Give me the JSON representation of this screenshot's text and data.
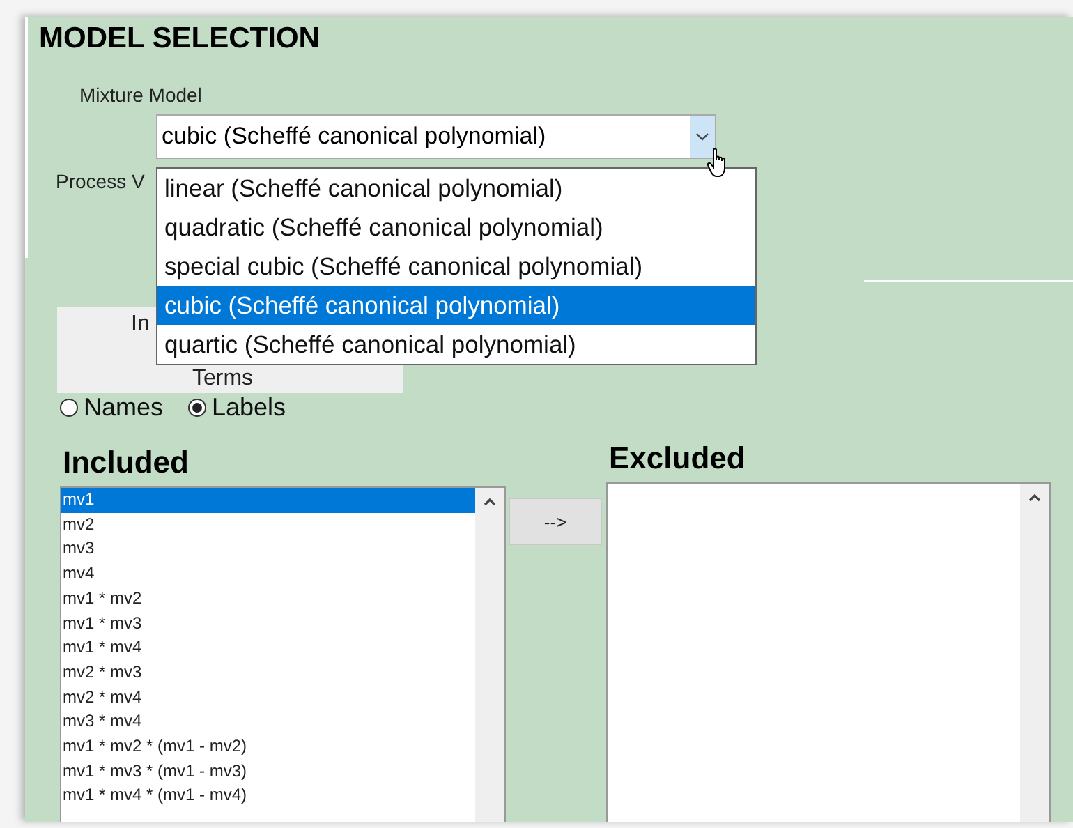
{
  "title": "MODEL SELECTION",
  "mixture_model": {
    "label": "Mixture Model",
    "value": "cubic (Scheffé canonical polynomial)",
    "expanded": true,
    "options": [
      {
        "label": "linear (Scheffé canonical polynomial)",
        "selected": false
      },
      {
        "label": "quadratic (Scheffé canonical polynomial)",
        "selected": false
      },
      {
        "label": "special cubic (Scheffé canonical polynomial)",
        "selected": false
      },
      {
        "label": "cubic (Scheffé canonical polynomial)",
        "selected": true
      },
      {
        "label": "quartic (Scheffé canonical polynomial)",
        "selected": false
      }
    ]
  },
  "process_label": "Process V",
  "terms_button": {
    "line_1": "In",
    "line_2": "Terms"
  },
  "display": [
    {
      "label": "Names",
      "selected": false
    },
    {
      "label": "Labels",
      "selected": true
    }
  ],
  "included": {
    "heading": "Included",
    "items": [
      {
        "label": "mv1",
        "selected": true
      },
      {
        "label": "mv2",
        "selected": false
      },
      {
        "label": "mv3",
        "selected": false
      },
      {
        "label": "mv4",
        "selected": false
      },
      {
        "label": "mv1 * mv2",
        "selected": false
      },
      {
        "label": "mv1 * mv3",
        "selected": false
      },
      {
        "label": "mv1 * mv4",
        "selected": false
      },
      {
        "label": "mv2 * mv3",
        "selected": false
      },
      {
        "label": "mv2 * mv4",
        "selected": false
      },
      {
        "label": "mv3 * mv4",
        "selected": false
      },
      {
        "label": "mv1 * mv2 * (mv1 - mv2)",
        "selected": false
      },
      {
        "label": "mv1 * mv3 * (mv1 - mv3)",
        "selected": false
      },
      {
        "label": "mv1 * mv4 * (mv1 - mv4)",
        "selected": false
      }
    ]
  },
  "move_button": "-->",
  "excluded": {
    "heading": "Excluded"
  }
}
